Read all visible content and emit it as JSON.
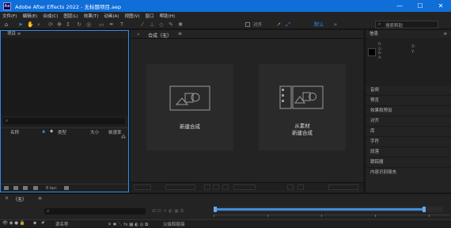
{
  "window": {
    "title": "Adobe After Effects 2022 - 无标题项目.aep",
    "app_icon": "Ae",
    "btn_min": "—",
    "btn_max": "☐",
    "btn_close": "✕"
  },
  "menu": [
    "文件(F)",
    "编辑(E)",
    "合成(C)",
    "图层(L)",
    "效果(T)",
    "动画(A)",
    "视图(V)",
    "窗口",
    "帮助(H)"
  ],
  "toolbar": {
    "snap_label": "对齐",
    "workspace": "默认",
    "search_placeholder": "搜索帮助"
  },
  "project": {
    "title": "项目",
    "col_name": "名称",
    "col_type": "类型",
    "col_size": "大小",
    "col_fps": "帧速率",
    "bpc": "8 bpc"
  },
  "composition": {
    "tab": "合成（无）",
    "new_comp": "新建合成",
    "from_footage_1": "从素材",
    "from_footage_2": "新建合成"
  },
  "right_panels": {
    "info_title": "信息",
    "info_rgba": [
      "R:",
      "G:",
      "B:",
      "A:"
    ],
    "info_xy": [
      "X:",
      "Y:"
    ],
    "items": [
      "音频",
      "预览",
      "效果和预设",
      "对齐",
      "库",
      "字符",
      "段落",
      "跟踪器",
      "内容识别填充"
    ]
  },
  "timeline": {
    "tab": "（无）",
    "layer_name_col": "源名称",
    "parent_col": "父级和链接"
  },
  "colors": {
    "accent": "#2d8ceb",
    "titlebar": "#0f6ed8"
  }
}
